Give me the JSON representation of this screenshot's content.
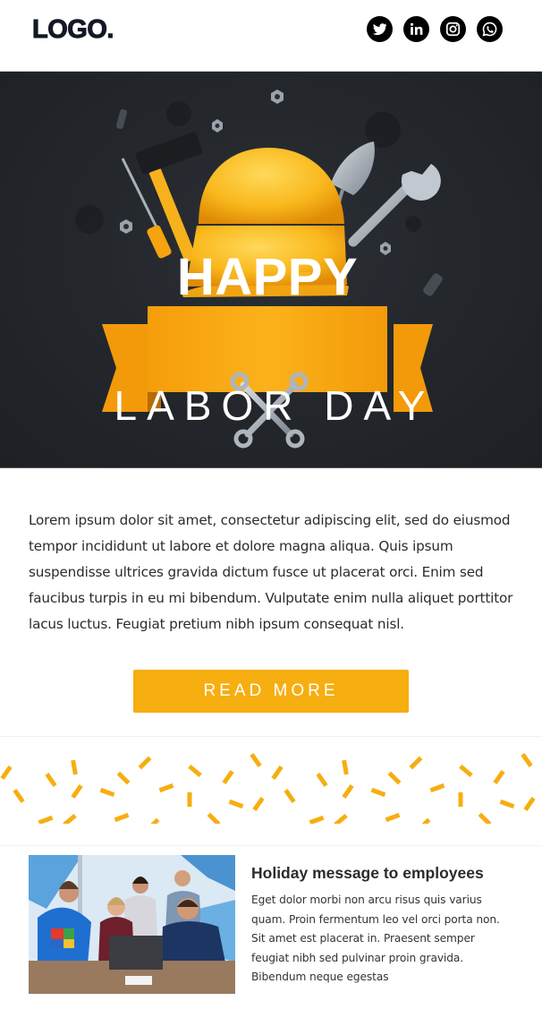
{
  "header": {
    "logo": "LOGO.",
    "socials": [
      {
        "name": "twitter",
        "icon": "twitter-icon"
      },
      {
        "name": "linkedin",
        "icon": "linkedin-icon"
      },
      {
        "name": "instagram",
        "icon": "instagram-icon"
      },
      {
        "name": "whatsapp",
        "icon": "whatsapp-icon"
      }
    ]
  },
  "hero": {
    "banner_text": "HAPPY",
    "headline": "LABOR DAY",
    "colors": {
      "background": "#24282d",
      "ribbon": "#f7a70f",
      "helmet": "#f9b81c"
    }
  },
  "body": {
    "paragraph": "Lorem ipsum dolor sit amet, consectetur adipiscing elit, sed do eiusmod tempor incididunt ut labore et dolore magna aliqua. Quis ipsum suspendisse ultrices gravida dictum fusce ut placerat orci. Enim sed faucibus turpis in eu mi bibendum. Vulputate enim nulla aliquet porttitor lacus luctus. Feugiat pretium nibh ipsum consequat nisl.",
    "cta_label": "READ MORE",
    "cta_color": "#f6ae10"
  },
  "confetti": {
    "color": "#f6ae10"
  },
  "article": {
    "title": "Holiday message to employees",
    "description": "Eget dolor morbi non arcu risus quis varius quam. Proin fermentum leo vel orci porta non. Sit amet est placerat in. Praesent semper feugiat nibh sed pulvinar proin gravida. Bibendum neque egestas",
    "image_alt": "group of coworkers celebrating around a laptop"
  }
}
